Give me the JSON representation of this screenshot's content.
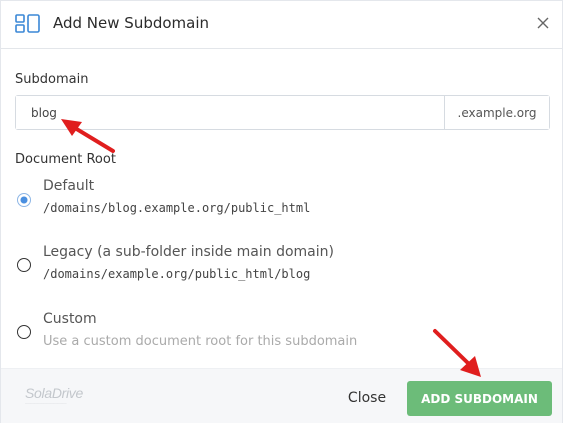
{
  "dialog": {
    "title": "Add New Subdomain",
    "header_icon": "subdomain-icon",
    "close_icon": "close-icon"
  },
  "subdomain": {
    "label": "Subdomain",
    "value": "blog",
    "suffix": ".example.org"
  },
  "document_root": {
    "label": "Document Root",
    "options": [
      {
        "title": "Default",
        "path": "/domains/blog.example.org/public_html",
        "selected": true
      },
      {
        "title": "Legacy (a sub-folder inside main domain)",
        "path": "/domains/example.org/public_html/blog",
        "selected": false
      },
      {
        "title": "Custom",
        "path": "Use a custom document root for this subdomain",
        "selected": false
      }
    ]
  },
  "footer": {
    "logo": "SolaDrive",
    "close_label": "Close",
    "add_label": "ADD SUBDOMAIN"
  },
  "annotations": {
    "arrow_color": "#e01e1e"
  },
  "colors": {
    "accent_green": "#6cbc79",
    "radio_blue": "#4a8fe0",
    "icon_blue": "#3a87d6"
  }
}
